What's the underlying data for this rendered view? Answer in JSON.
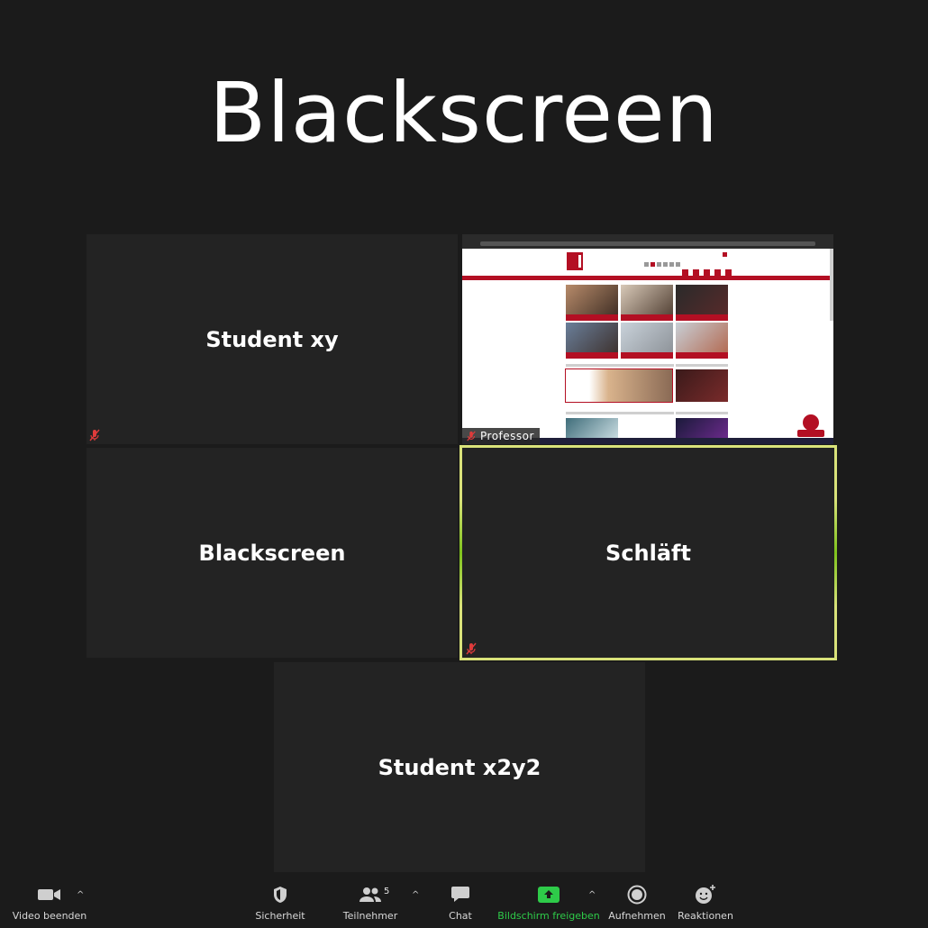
{
  "headline": "Blackscreen",
  "tiles": [
    {
      "name": "Student xy",
      "muted": true
    },
    {
      "name": "Blackscreen",
      "muted": false
    },
    {
      "name": "Schläft",
      "muted": true,
      "active_speaker": true
    },
    {
      "name": "Student x2y2",
      "muted": false
    }
  ],
  "share": {
    "presenter": "Professor",
    "muted": true
  },
  "toolbar": {
    "video": "Video beenden",
    "security": "Sicherheit",
    "participants": "Teilnehmer",
    "participants_count": "5",
    "chat": "Chat",
    "share_screen": "Bildschirm freigeben",
    "record": "Aufnehmen",
    "reactions": "Reaktionen"
  },
  "colors": {
    "background": "#1b1b1b",
    "tile": "#232323",
    "active_border": "#d9e27a",
    "share_green": "#2ecb49",
    "brand_red": "#b30f23"
  },
  "icons": [
    "muted-mic-icon",
    "video-camera-icon",
    "shield-icon",
    "participants-icon",
    "chat-bubble-icon",
    "share-screen-icon",
    "record-icon",
    "reaction-icon",
    "chevron-up-icon"
  ]
}
